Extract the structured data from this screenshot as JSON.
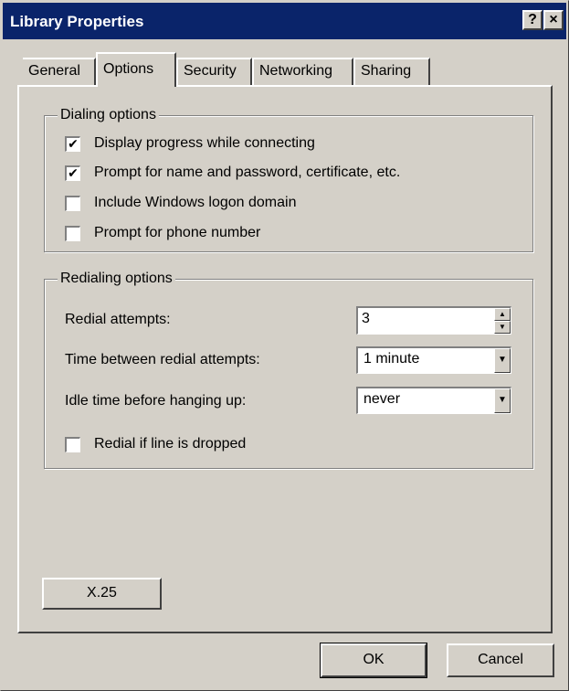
{
  "window": {
    "title": "Library Properties",
    "help_glyph": "?",
    "close_glyph": "×"
  },
  "tabs": [
    {
      "label": "General"
    },
    {
      "label": "Options"
    },
    {
      "label": "Security"
    },
    {
      "label": "Networking"
    },
    {
      "label": "Sharing"
    }
  ],
  "active_tab": "Options",
  "dialing": {
    "title": "Dialing options",
    "items": [
      {
        "label": "Display progress while connecting",
        "checked": true
      },
      {
        "label": "Prompt for name and password, certificate, etc.",
        "checked": true
      },
      {
        "label": "Include Windows logon domain",
        "checked": false
      },
      {
        "label": "Prompt for phone number",
        "checked": false
      }
    ]
  },
  "redialing": {
    "title": "Redialing options",
    "attempts_label": "Redial attempts:",
    "attempts_value": "3",
    "time_label": "Time between redial attempts:",
    "time_value": "1 minute",
    "idle_label": "Idle time before hanging up:",
    "idle_value": "never",
    "redial_dropped_label": "Redial if line is dropped",
    "redial_dropped_checked": false
  },
  "x25_button": "X.25",
  "footer": {
    "ok": "OK",
    "cancel": "Cancel"
  },
  "colors": {
    "titlebar": "#0a246a",
    "face": "#d4d0c8"
  }
}
